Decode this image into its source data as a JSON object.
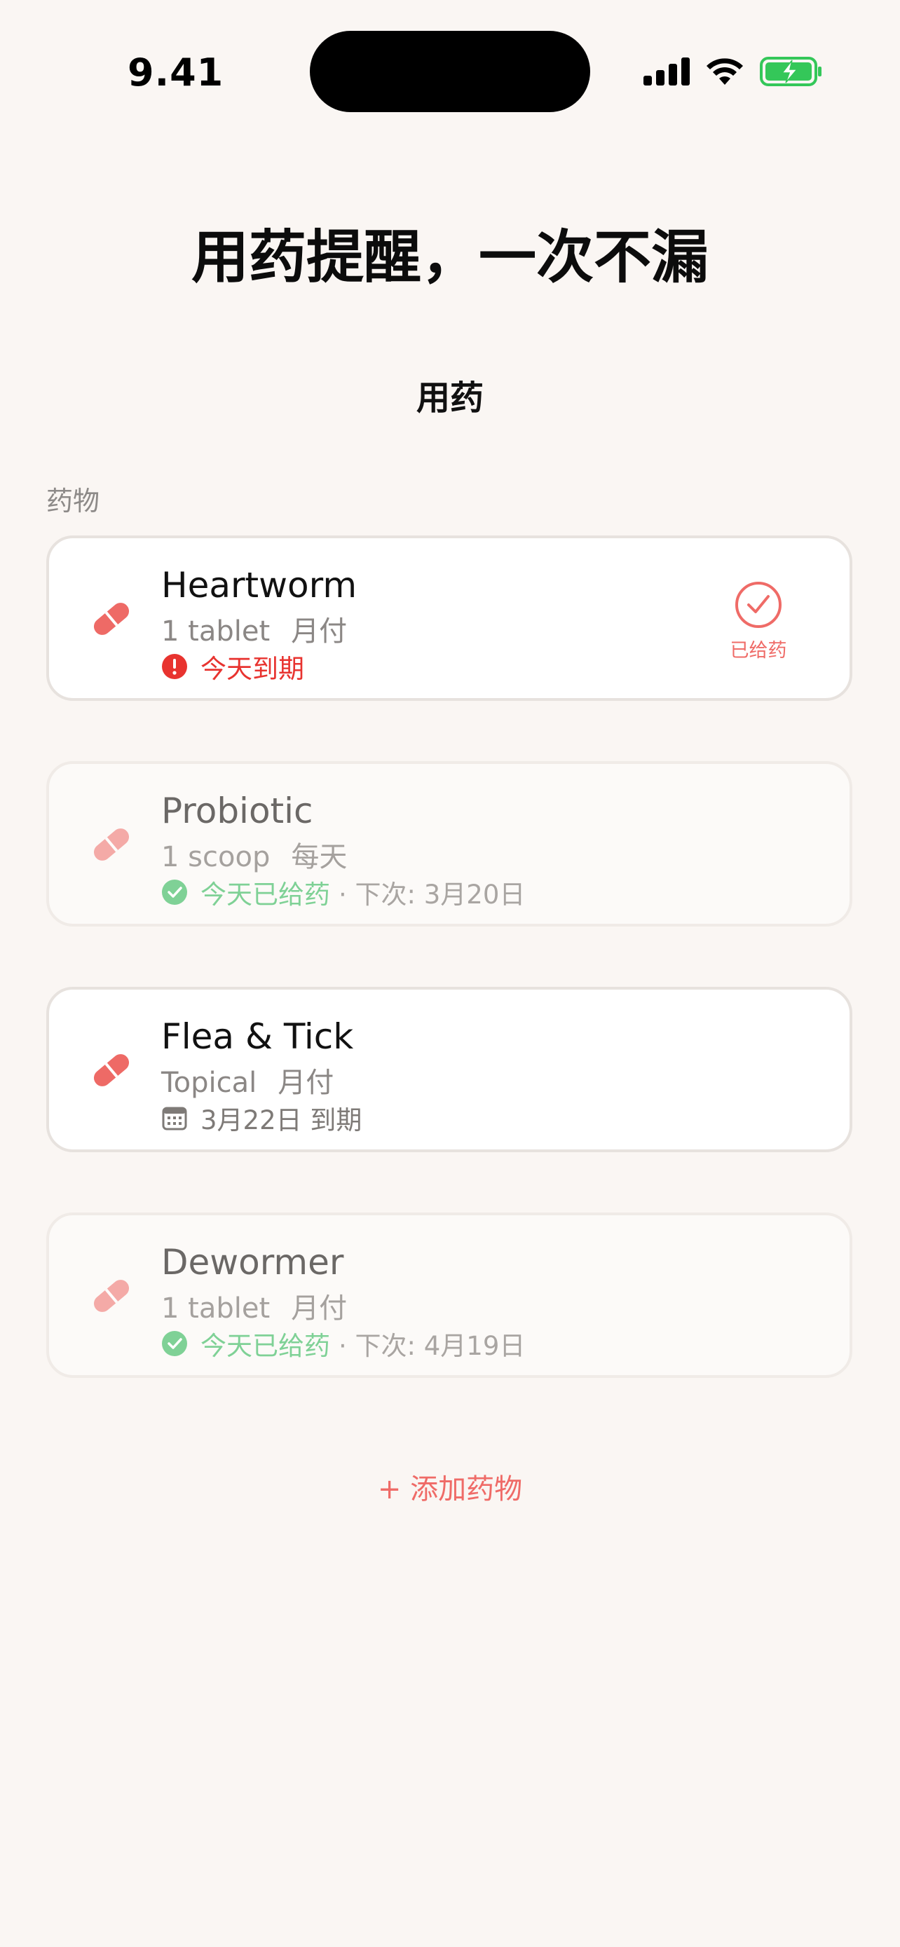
{
  "status_bar": {
    "time": "9.41"
  },
  "headline": "用药提醒，一次不漏",
  "nav_title": "用药",
  "section_label": "药物",
  "medications": [
    {
      "name": "Heartworm",
      "dose": "1 tablet",
      "frequency": "月付",
      "status_text": "今天到期",
      "given_button_label": "已给药"
    },
    {
      "name": "Probiotic",
      "dose": "1 scoop",
      "frequency": "每天",
      "status_text": "今天已给药",
      "next_text": "· 下次: 3月20日"
    },
    {
      "name": "Flea & Tick",
      "dose": "Topical",
      "frequency": "月付",
      "status_text": "3月22日 到期"
    },
    {
      "name": "Dewormer",
      "dose": "1 tablet",
      "frequency": "月付",
      "status_text": "今天已给药",
      "next_text": "· 下次: 4月19日"
    }
  ],
  "add_button_label": "+ 添加药物",
  "colors": {
    "background": "#faf6f3",
    "accent": "#ef6b67",
    "due_red": "#e8332f",
    "given_green": "#7fd196",
    "battery_green": "#34c759"
  }
}
